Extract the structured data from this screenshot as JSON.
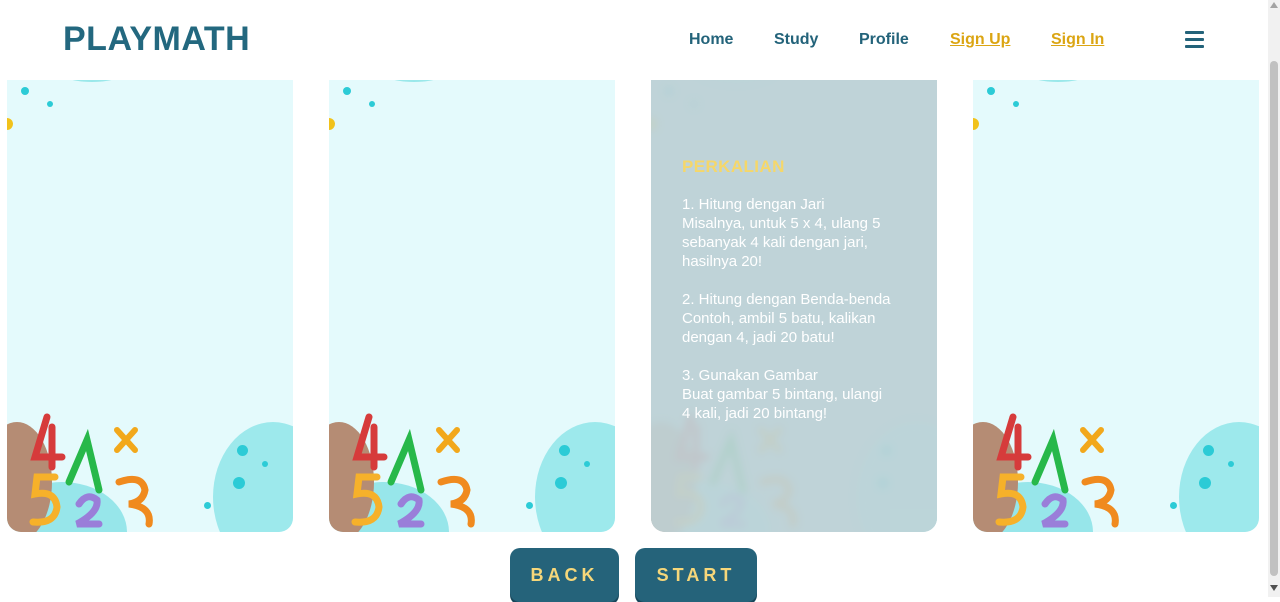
{
  "header": {
    "logo": "PLAYMATH",
    "nav": [
      {
        "label": "Home",
        "auth": false
      },
      {
        "label": "Study",
        "auth": false
      },
      {
        "label": "Profile",
        "auth": false
      },
      {
        "label": "Sign Up",
        "auth": true
      },
      {
        "label": "Sign In",
        "auth": true
      }
    ],
    "menu_icon": "hamburger-menu-icon"
  },
  "active_card": {
    "title": "PERKALIAN",
    "tips": [
      {
        "heading": "1. Hitung dengan Jari",
        "body": [
          "Misalnya, untuk 5 x 4, ulang 5",
          "sebanyak 4 kali dengan jari,",
          "hasilnya 20!"
        ]
      },
      {
        "heading": "2. Hitung dengan Benda-benda",
        "body": [
          "Contoh, ambil 5 batu, kalikan",
          "dengan 4, jadi 20 batu!"
        ]
      },
      {
        "heading": "3. Gunakan Gambar",
        "body": [
          "Buat gambar 5 bintang, ulangi",
          "4 kali, jadi 20 bintang!"
        ]
      }
    ]
  },
  "buttons": {
    "back": "BACK",
    "start": "START"
  },
  "colors": {
    "brand": "#23687f",
    "accent": "#dba513",
    "button_bg": "#25637a",
    "button_text": "#f6d77a"
  }
}
